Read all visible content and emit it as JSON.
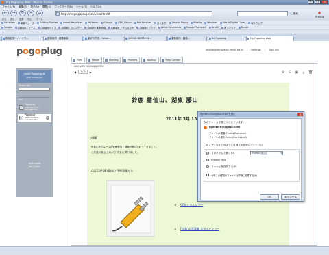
{
  "window": {
    "title": "My Pogoplug Web - Mozilla Firefox"
  },
  "menu": [
    "ファイル(F)",
    "編集(E)",
    "表示(V)",
    "履歴(S)",
    "ブックマーク(B)",
    "ツール(T)",
    "ヘルプ(H)"
  ],
  "nav": {
    "back_label": "戻る",
    "forward_label": "進む",
    "reload_label": "更新",
    "stop_label": "中止",
    "home_label": "ホーム",
    "url": "http://my.pogoplug.com/view.html#",
    "search_placeholder": "",
    "search_button": "検索",
    "firebug": "Firebug"
  },
  "bookmarks_row1": [
    "Geocities",
    "最新ニュース",
    "Getting Started",
    "Latest Headlines",
    "MyYahoo",
    "iGoogle",
    "CRS_Album",
    "Net Services",
    "ひぐまり",
    "Ubuntu Pappy",
    "Mozilla",
    "Windows",
    "World Digital Librar",
    "海外ウェブ"
  ],
  "bookmarks_row2": [
    "Google",
    "Googleニュース",
    "Googleマップ",
    "Google カレンダー",
    "Google 画像検索",
    "Google ドキュメント",
    "Google ブック",
    "World Panoramas",
    "Google Translate",
    "Gmail",
    "オプション",
    "Sendo"
  ],
  "tabs": [
    {
      "label": "既存記録 - バイナウ...",
      "active": false
    },
    {
      "label": "乗換案内 | 経路探索",
      "active": false
    },
    {
      "label": "鶴沢の方言 - Yahoo...",
      "active": false
    },
    {
      "label": "SCHIVE GEMAT E2...",
      "active": false
    },
    {
      "label": "乗換案内 | 経路...",
      "active": false
    },
    {
      "label": "Bd Pogoplug",
      "active": false
    },
    {
      "label": "My Pogoplug Web",
      "active": true
    }
  ],
  "app": {
    "logo_text": "pogoplug",
    "user_email": "yosida@kanagawa.email.ne.jp",
    "settings_label": "Settings",
    "signout_label": "Sign out"
  },
  "sidebar": {
    "install_text_1": "Install Pogoplug on",
    "install_text_2": "your computer",
    "search_label": "Search for:",
    "section_label": "Info",
    "devices": [
      {
        "name": "Pogoplug",
        "detail1": "WWW.Vaio Ext4...",
        "detail2": "Last seen Moo",
        "selected": false
      },
      {
        "name": "Pogoplug",
        "detail1": "WWW.Vaio Ext4...",
        "detail2": "Last seen Moo",
        "selected": true
      }
    ],
    "view_mode_label": "view mode",
    "view_mode_value": "list | icons"
  },
  "main": {
    "tabs": [
      {
        "label": "Files",
        "icon": "folder-icon",
        "active": true
      },
      {
        "label": "Media",
        "icon": "media-icon",
        "active": false
      },
      {
        "label": "Sharing",
        "icon": "share-icon",
        "active": false
      },
      {
        "label": "Printers",
        "icon": "printer-icon",
        "active": false
      },
      {
        "label": "Backup",
        "icon": "backup-icon",
        "active": false
      },
      {
        "label": "Help Center",
        "icon": "help-icon",
        "active": false
      }
    ],
    "filepath": "WBC WEB EAS.WWW.WWW",
    "pager": {
      "current": "1",
      "total": "2"
    }
  },
  "document": {
    "title": "鈴鹿 霊仙山、湖東 藤山",
    "date": "2011年 5月 15-16 日",
    "section1": "◇概要",
    "para1_line1": "所属山岳グループの鈴鹿霊仙・湖東鈴鹿に加わってきました。",
    "para1_line2": "と鈴鹿の藤山(きねがさ ずま)に寄りました。",
    "section2": "◇5月15日(晴)霊仙山 田原見服から",
    "link1": "GPS トライショー",
    "link2": "Flickr の写真集 スライドショー"
  },
  "dialog": {
    "title": "Ryozen-Kinugasa.html を開く",
    "prompt": "次のファイルを開こうとしています:",
    "filename": "Ryozen-Kinugasa.html",
    "filetype_label": "ファイルの種類: Firefox Document",
    "source_label": "ファイルの場所: http://mtr.ikkb.n1/",
    "question": "このファイルをどのように処理するか選んでください",
    "option_open": "プログラムで開く(O)",
    "app_select": "Firefox (既定)",
    "option_other": "Browse 作成",
    "option_save": "ファイルを保存する(S)",
    "checkbox": "今後この種類のファイルは同様に処理する(A)",
    "ok": "OK",
    "cancel": "キャンセル"
  },
  "status": {
    "left": "",
    "right": ""
  }
}
